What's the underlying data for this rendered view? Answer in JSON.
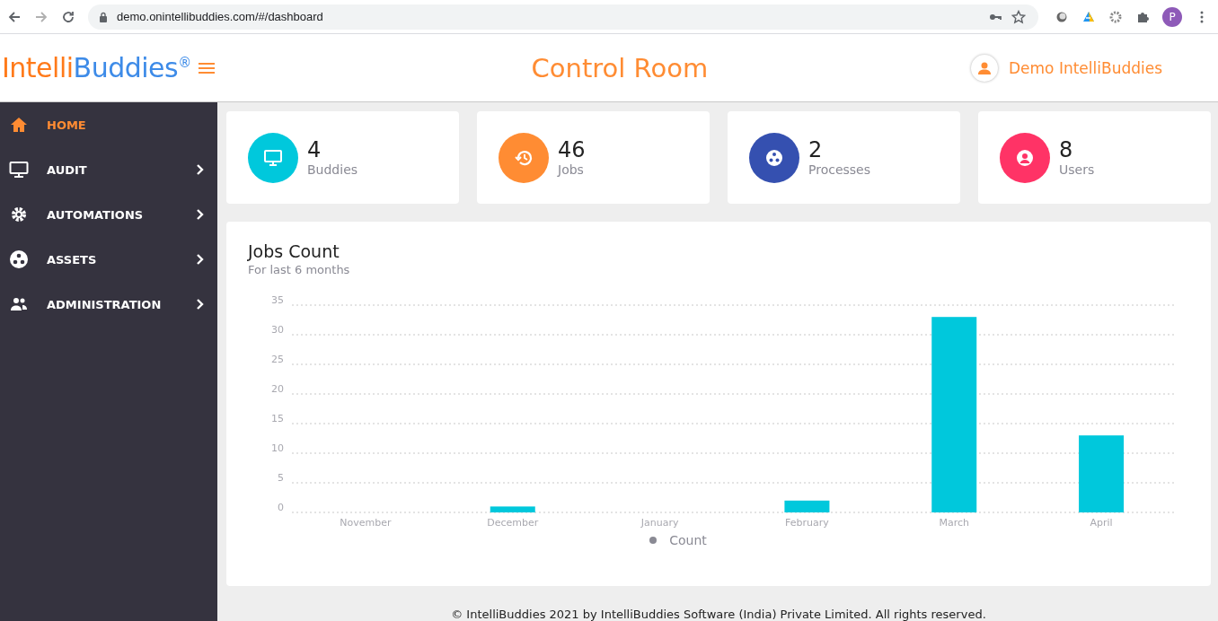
{
  "browser": {
    "url": "demo.onintellibuddies.com/#/dashboard",
    "profile_initial": "P"
  },
  "header": {
    "logo": {
      "parts": [
        "Intelli",
        "Buddies"
      ],
      "mark": "®"
    },
    "title": "Control Room",
    "user": "Demo IntelliBuddies"
  },
  "sidebar": {
    "items": [
      {
        "label": "HOME",
        "selected": true,
        "expandable": false
      },
      {
        "label": "AUDIT",
        "selected": false,
        "expandable": true
      },
      {
        "label": "AUTOMATIONS",
        "selected": false,
        "expandable": true
      },
      {
        "label": "ASSETS",
        "selected": false,
        "expandable": true
      },
      {
        "label": "ADMINISTRATION",
        "selected": false,
        "expandable": true
      }
    ]
  },
  "stats": [
    {
      "value": "4",
      "label": "Buddies",
      "color": "#00c8dc"
    },
    {
      "value": "46",
      "label": "Jobs",
      "color": "#ff8c33"
    },
    {
      "value": "2",
      "label": "Processes",
      "color": "#3550b0"
    },
    {
      "value": "8",
      "label": "Users",
      "color": "#ff3366"
    }
  ],
  "jobs_chart": {
    "title": "Jobs Count",
    "subtitle": "For last 6 months",
    "chart_data": {
      "type": "bar",
      "categories": [
        "November",
        "December",
        "January",
        "February",
        "March",
        "April"
      ],
      "series": [
        {
          "name": "Count",
          "color": "#00c8dc",
          "values": [
            0,
            1,
            0,
            2,
            33,
            13
          ]
        }
      ],
      "ylim": [
        0,
        35
      ],
      "grid": true,
      "yticks": [
        0,
        5,
        10,
        15,
        20,
        25,
        30,
        35
      ]
    }
  },
  "footer": "© IntelliBuddies 2021 by IntelliBuddies Software (India) Private Limited. All rights reserved."
}
